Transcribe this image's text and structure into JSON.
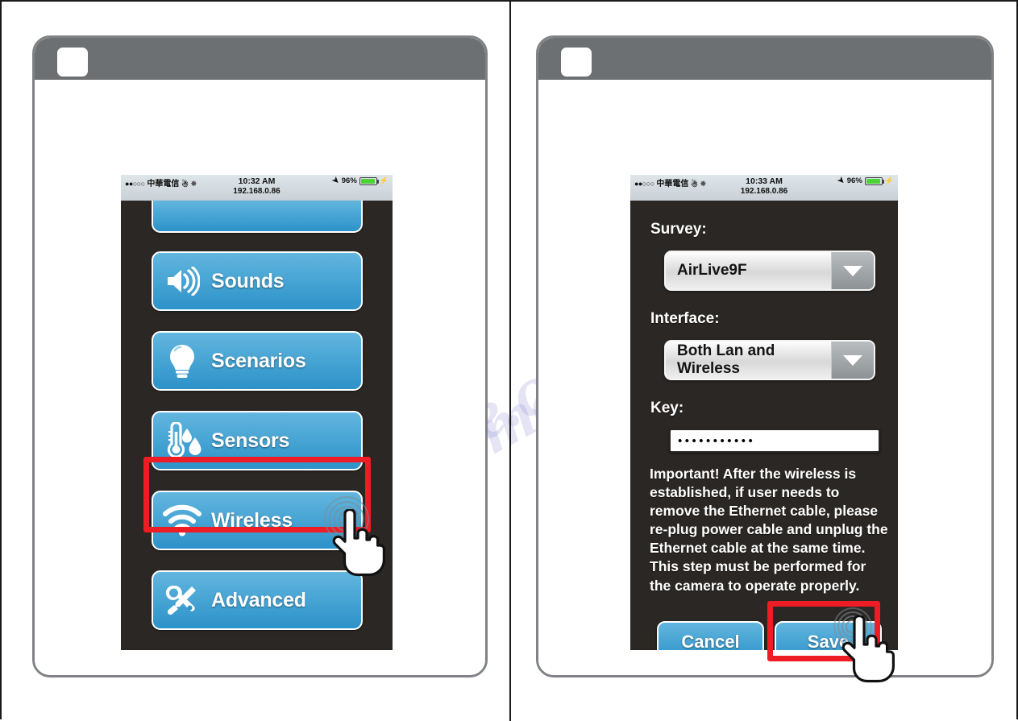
{
  "panels": [
    {
      "id": "left",
      "status_bar": {
        "signal_dots": "●●○○○",
        "carrier": "中華電信",
        "wifi_icon": "wifi-icon",
        "gear_icon": "gear-icon",
        "time": "10:32 AM",
        "url": "192.168.0.86",
        "location_icon": "location-arrow-icon",
        "battery_percent": "96%",
        "battery_level": 96,
        "charging_icon": "charging-bolt-icon"
      },
      "menu_items": [
        {
          "label": "",
          "icon": "clipped-button",
          "clipped": true
        },
        {
          "label": "Sounds",
          "icon": "speaker-icon",
          "clipped": false
        },
        {
          "label": "Scenarios",
          "icon": "lightbulb-icon",
          "clipped": false
        },
        {
          "label": "Sensors",
          "icon": "thermometer-droplet-icon",
          "clipped": false
        },
        {
          "label": "Wireless",
          "icon": "wifi-signal-icon",
          "clipped": false,
          "highlighted": true
        },
        {
          "label": "Advanced",
          "icon": "wrench-screwdriver-icon",
          "clipped": false
        }
      ],
      "highlight_target": "Wireless",
      "cursor": "pointing-hand-cursor"
    },
    {
      "id": "right",
      "status_bar": {
        "signal_dots": "●●○○○",
        "carrier": "中華電信",
        "wifi_icon": "wifi-icon",
        "gear_icon": "gear-icon",
        "time": "10:33 AM",
        "url": "192.168.0.86",
        "location_icon": "location-arrow-icon",
        "battery_percent": "96%",
        "battery_level": 96,
        "charging_icon": "charging-bolt-icon"
      },
      "form": {
        "survey_label": "Survey:",
        "survey_value": "AirLive9F",
        "interface_label": "Interface:",
        "interface_value": "Both Lan and Wireless",
        "key_label": "Key:",
        "key_value": "•••••••••••",
        "notice": "Important! After the wireless is established, if user needs to remove the Ethernet cable, please re-plug power cable and unplug the Ethernet cable at the same time. This step must be performed for the camera to operate properly.",
        "cancel_label": "Cancel",
        "save_label": "Save"
      },
      "highlight_target": "Save",
      "cursor": "pointing-hand-cursor"
    }
  ],
  "watermark": "manualshive.com",
  "colors": {
    "button_blue_top": "#62b6de",
    "button_blue_bottom": "#2c92c9",
    "highlight_red": "#ee1c25",
    "screen_dark": "#2b2724",
    "frame_grey": "#808285",
    "header_grey": "#6d7073",
    "battery_green": "#4cd336"
  }
}
